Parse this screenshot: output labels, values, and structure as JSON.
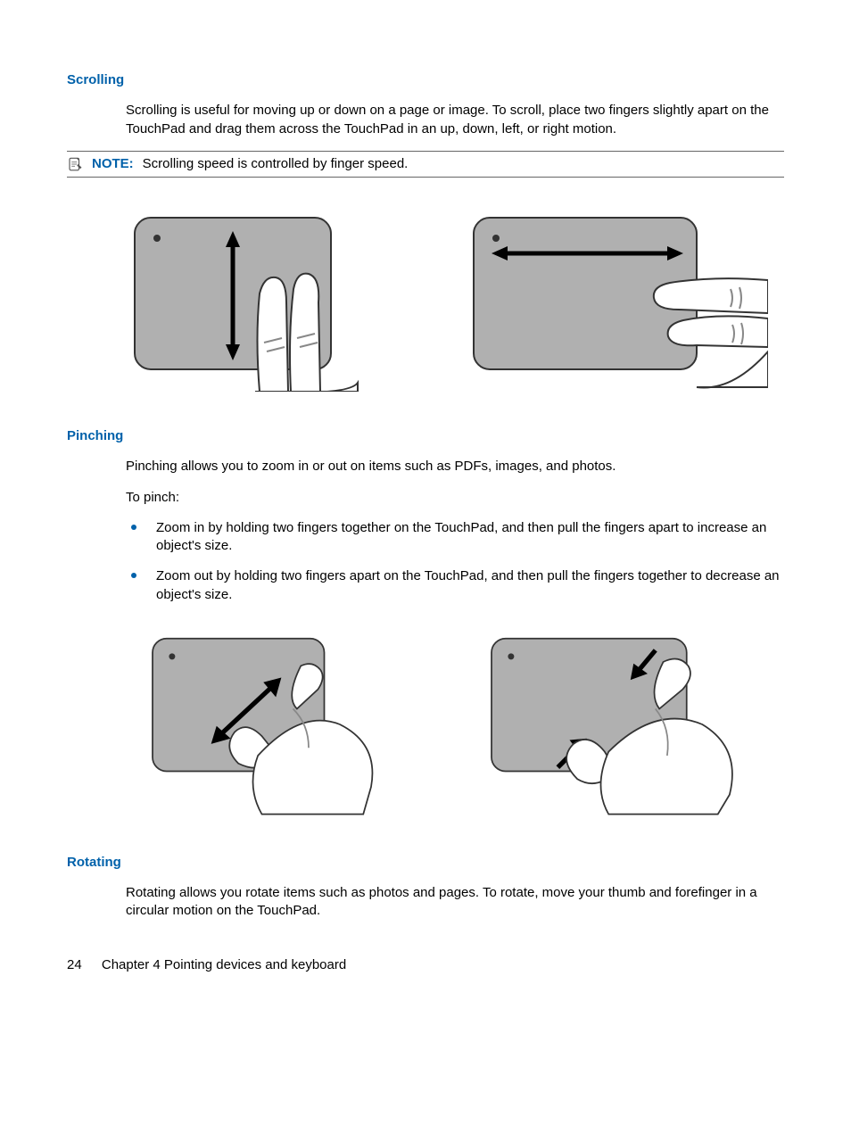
{
  "sections": {
    "scrolling": {
      "heading": "Scrolling",
      "body": "Scrolling is useful for moving up or down on a page or image. To scroll, place two fingers slightly apart on the TouchPad and drag them across the TouchPad in an up, down, left, or right motion.",
      "note_label": "NOTE:",
      "note_text": "Scrolling speed is controlled by finger speed."
    },
    "pinching": {
      "heading": "Pinching",
      "body1": "Pinching allows you to zoom in or out on items such as PDFs, images, and photos.",
      "body2": "To pinch:",
      "bullets": [
        "Zoom in by holding two fingers together on the TouchPad, and then pull the fingers apart to increase an object's size.",
        "Zoom out by holding two fingers apart on the TouchPad, and then pull the fingers together to decrease an object's size."
      ]
    },
    "rotating": {
      "heading": "Rotating",
      "body": "Rotating allows you rotate items such as photos and pages. To rotate, move your thumb and forefinger in a circular motion on the TouchPad."
    }
  },
  "footer": {
    "page_number": "24",
    "chapter": "Chapter 4   Pointing devices and keyboard"
  }
}
